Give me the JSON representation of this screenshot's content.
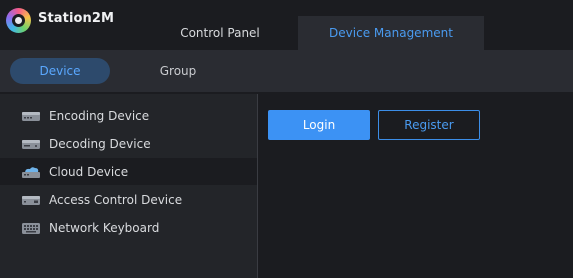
{
  "app": {
    "name": "Station2M"
  },
  "top_tabs": [
    {
      "label": "Control Panel"
    },
    {
      "label": "Device Management"
    }
  ],
  "sub_tabs": [
    {
      "label": "Device"
    },
    {
      "label": "Group"
    }
  ],
  "sidebar": {
    "items": [
      {
        "label": "Encoding Device",
        "icon": "encoder-icon"
      },
      {
        "label": "Decoding Device",
        "icon": "decoder-icon"
      },
      {
        "label": "Cloud Device",
        "icon": "cloud-device-icon"
      },
      {
        "label": "Access Control Device",
        "icon": "access-control-icon"
      },
      {
        "label": "Network Keyboard",
        "icon": "keyboard-icon"
      }
    ],
    "active_index": 2
  },
  "panel": {
    "login_label": "Login",
    "register_label": "Register"
  },
  "colors": {
    "accent": "#3c92f4",
    "background": "#1b1c20",
    "nav_bg": "#2a2c32",
    "sidebar_bg": "#232529"
  }
}
